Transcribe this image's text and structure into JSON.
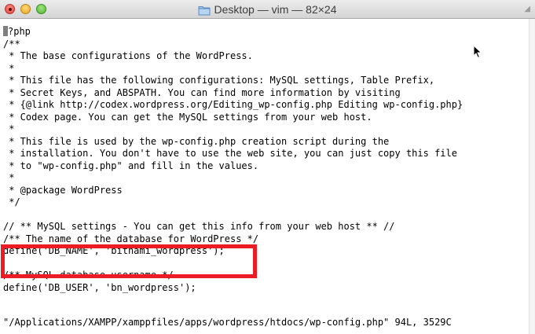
{
  "window": {
    "title": "Desktop — vim — 82×24",
    "status_line": "\"/Applications/XAMPP/xamppfiles/apps/wordpress/htdocs/wp-config.php\" 94L, 3529C"
  },
  "editor": {
    "first_line_rest": "?php",
    "lines": [
      "/**",
      " * The base configurations of the WordPress.",
      " *",
      " * This file has the following configurations: MySQL settings, Table Prefix,",
      " * Secret Keys, and ABSPATH. You can find more information by visiting",
      " * {@link http://codex.wordpress.org/Editing_wp-config.php Editing wp-config.php}",
      " * Codex page. You can get the MySQL settings from your web host.",
      " *",
      " * This file is used by the wp-config.php creation script during the",
      " * installation. You don't have to use the web site, you can just copy this file",
      " * to \"wp-config.php\" and fill in the values.",
      " *",
      " * @package WordPress",
      " */",
      "",
      "// ** MySQL settings - You can get this info from your web host ** //",
      "/** The name of the database for WordPress */",
      "define('DB_NAME', 'bitnami_wordpress');",
      "",
      "/** MySQL database username */",
      "define('DB_USER', 'bn_wordpress');",
      ""
    ]
  },
  "icons": {
    "close": "close-icon",
    "minimize": "minimize-icon",
    "zoom": "zoom-icon",
    "folder": "folder-icon",
    "pointer": "mouse-pointer-icon"
  },
  "colors": {
    "highlight": "#ec1c24",
    "cursor": "#7f7f7f"
  }
}
